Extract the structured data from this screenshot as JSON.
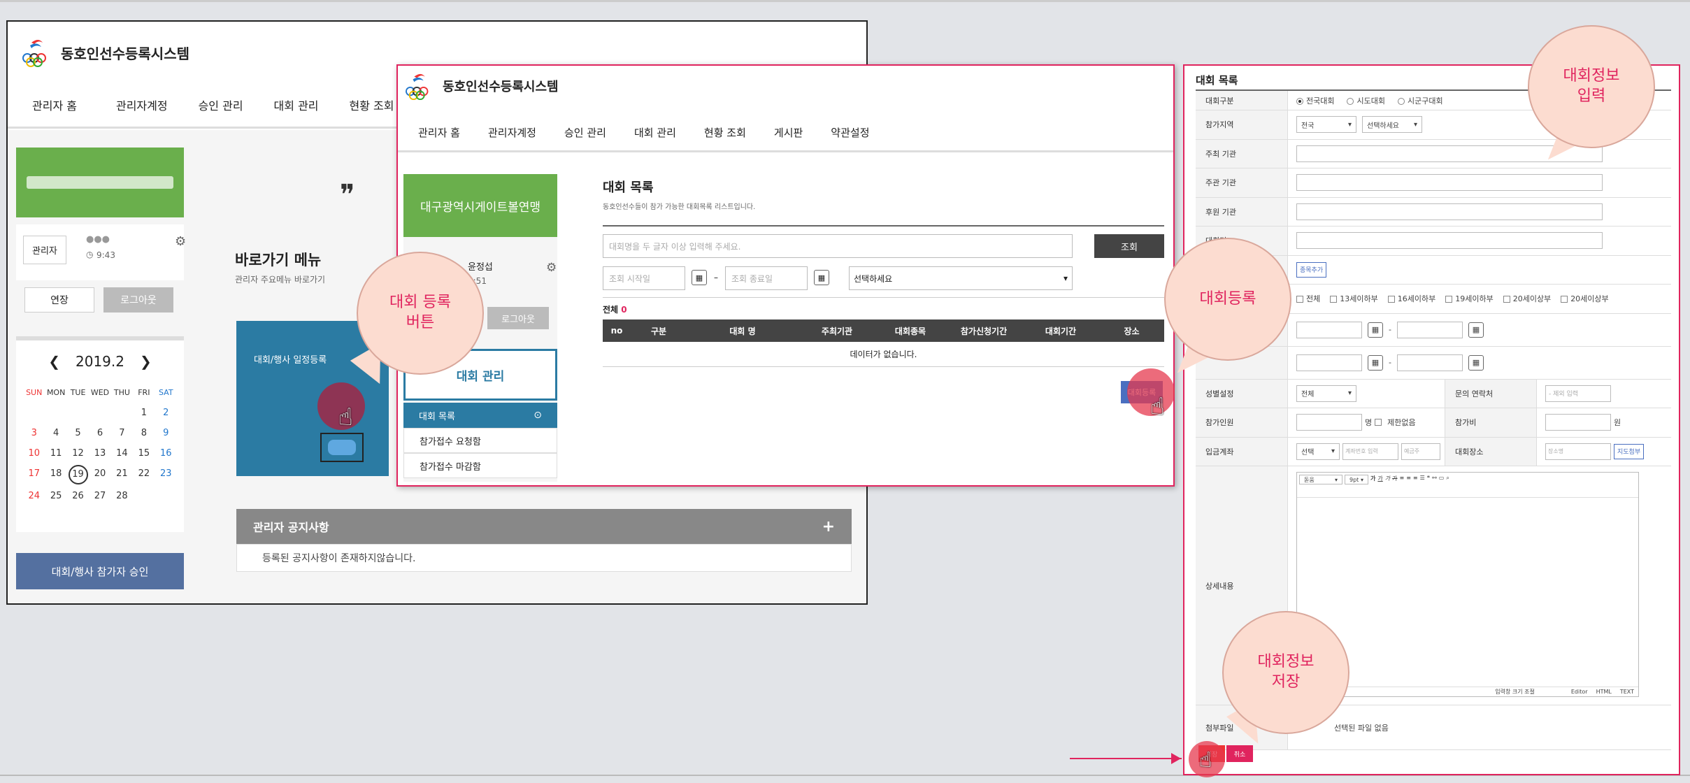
{
  "win1": {
    "logo": "동호인선수등록시스템",
    "nav": [
      "관리자 홈",
      "관리자계정",
      "승인 관리",
      "대회 관리",
      "현황 조회"
    ],
    "user_role": "관리자",
    "user_name": "●●●",
    "time": "9:43",
    "btn_edit": "연장",
    "btn_logout": "로그아웃",
    "quote_mark": "❞",
    "shortcut_title": "바로가기 메뉴",
    "shortcut_sub": "관리자 주요메뉴 바로가기",
    "tile_label": "대회/행사 일정등록",
    "calendar": {
      "month": "2019.2",
      "days": [
        "SUN",
        "MON",
        "TUE",
        "WED",
        "THU",
        "FRI",
        "SAT"
      ],
      "weeks": [
        [
          "",
          "",
          "",
          "",
          "",
          "1",
          "2"
        ],
        [
          "3",
          "4",
          "5",
          "6",
          "7",
          "8",
          "9"
        ],
        [
          "10",
          "11",
          "12",
          "13",
          "14",
          "15",
          "16"
        ],
        [
          "17",
          "18",
          "19",
          "20",
          "21",
          "22",
          "23"
        ],
        [
          "24",
          "25",
          "26",
          "27",
          "28",
          "",
          ""
        ]
      ],
      "today": "19"
    },
    "approve_btn": "대회/행사 참가자 승인",
    "notice_title": "관리자 공지사항",
    "notice_plus": "+",
    "notice_empty": "등록된 공지사항이 존재하지않습니다."
  },
  "win2": {
    "logo": "동호인선수등록시스템",
    "nav": [
      "관리자 홈",
      "관리자계정",
      "승인 관리",
      "대회 관리",
      "현황 조회",
      "게시판",
      "약관설정"
    ],
    "org_name": "대구광역시게이트볼연맹",
    "user_name": "윤정섭",
    "time": "9:51",
    "btn_logout": "로그아웃",
    "side_title": "대회 관리",
    "side_items": [
      "대회 목록",
      "참가접수 요청함",
      "참가접수 마감함"
    ],
    "page_title": "대회 목록",
    "page_sub": "동호인선수들이 참가 가능한 대회목록 리스트입니다.",
    "search_placeholder": "대회명을 두 글자 이상 입력해 주세요.",
    "search_btn": "조회",
    "date_start_placeholder": "조회 시작일",
    "date_end_placeholder": "조회 종료일",
    "select_default": "선택하세요",
    "total_label": "전체",
    "total_count": "0",
    "columns": [
      "no",
      "구분",
      "대회 명",
      "주최기관",
      "대회종목",
      "참가신청기간",
      "대회기간",
      "장소"
    ],
    "empty_text": "데이터가 없습니다.",
    "register_btn": "대회등록"
  },
  "win3": {
    "title": "대회 목록",
    "rows": {
      "type_label": "대회구분",
      "type_options": [
        "전국대회",
        "시도대회",
        "시군구대회"
      ],
      "region_label": "참가지역",
      "region_sel1": "전국",
      "region_sel2": "선택하세요",
      "host_label": "주최 기관",
      "organizer_label": "주관 기관",
      "sponsor_label": "후원 기관",
      "name_label": "대회명",
      "add_event_btn": "종목추가",
      "age_options": [
        "전체",
        "13세이하부",
        "16세이하부",
        "19세이하부",
        "20세이상부",
        "20세이상부"
      ],
      "gender_label": "성별설정",
      "gender_value": "전체",
      "contact_label": "문의 연락처",
      "contact_placeholder": "- 제외 입력",
      "people_label": "참가인원",
      "people_unit": "명",
      "people_unlimited": "제한없음",
      "fee_label": "참가비",
      "fee_unit": "원",
      "account_label": "입금계좌",
      "account_select": "선택",
      "account_placeholder": "계좌번호 입력",
      "holder_placeholder": "예금주",
      "venue_label": "대회장소",
      "venue_placeholder": "장소명",
      "map_btn": "지도첨부",
      "detail_label": "상세내용",
      "editor_font": "돋움",
      "editor_size": "9pt",
      "editor_resize": "입력창 크기 조절",
      "editor_tabs": [
        "Editor",
        "HTML",
        "TEXT"
      ],
      "file_label": "첨부파일",
      "file_text": "선택된 파일 없음"
    },
    "save_btn": "저장",
    "cancel_btn": "취소"
  },
  "callouts": {
    "register_button": "대회 등록\n버튼",
    "register": "대회등록",
    "input_info": "대회정보\n입력",
    "save_info": "대회정보\n저장"
  },
  "colors": {
    "accent_pink": "#e0245e",
    "green": "#6aaf4c",
    "teal": "#2b7ba3",
    "navy": "#5470a0",
    "dark": "#444444"
  }
}
